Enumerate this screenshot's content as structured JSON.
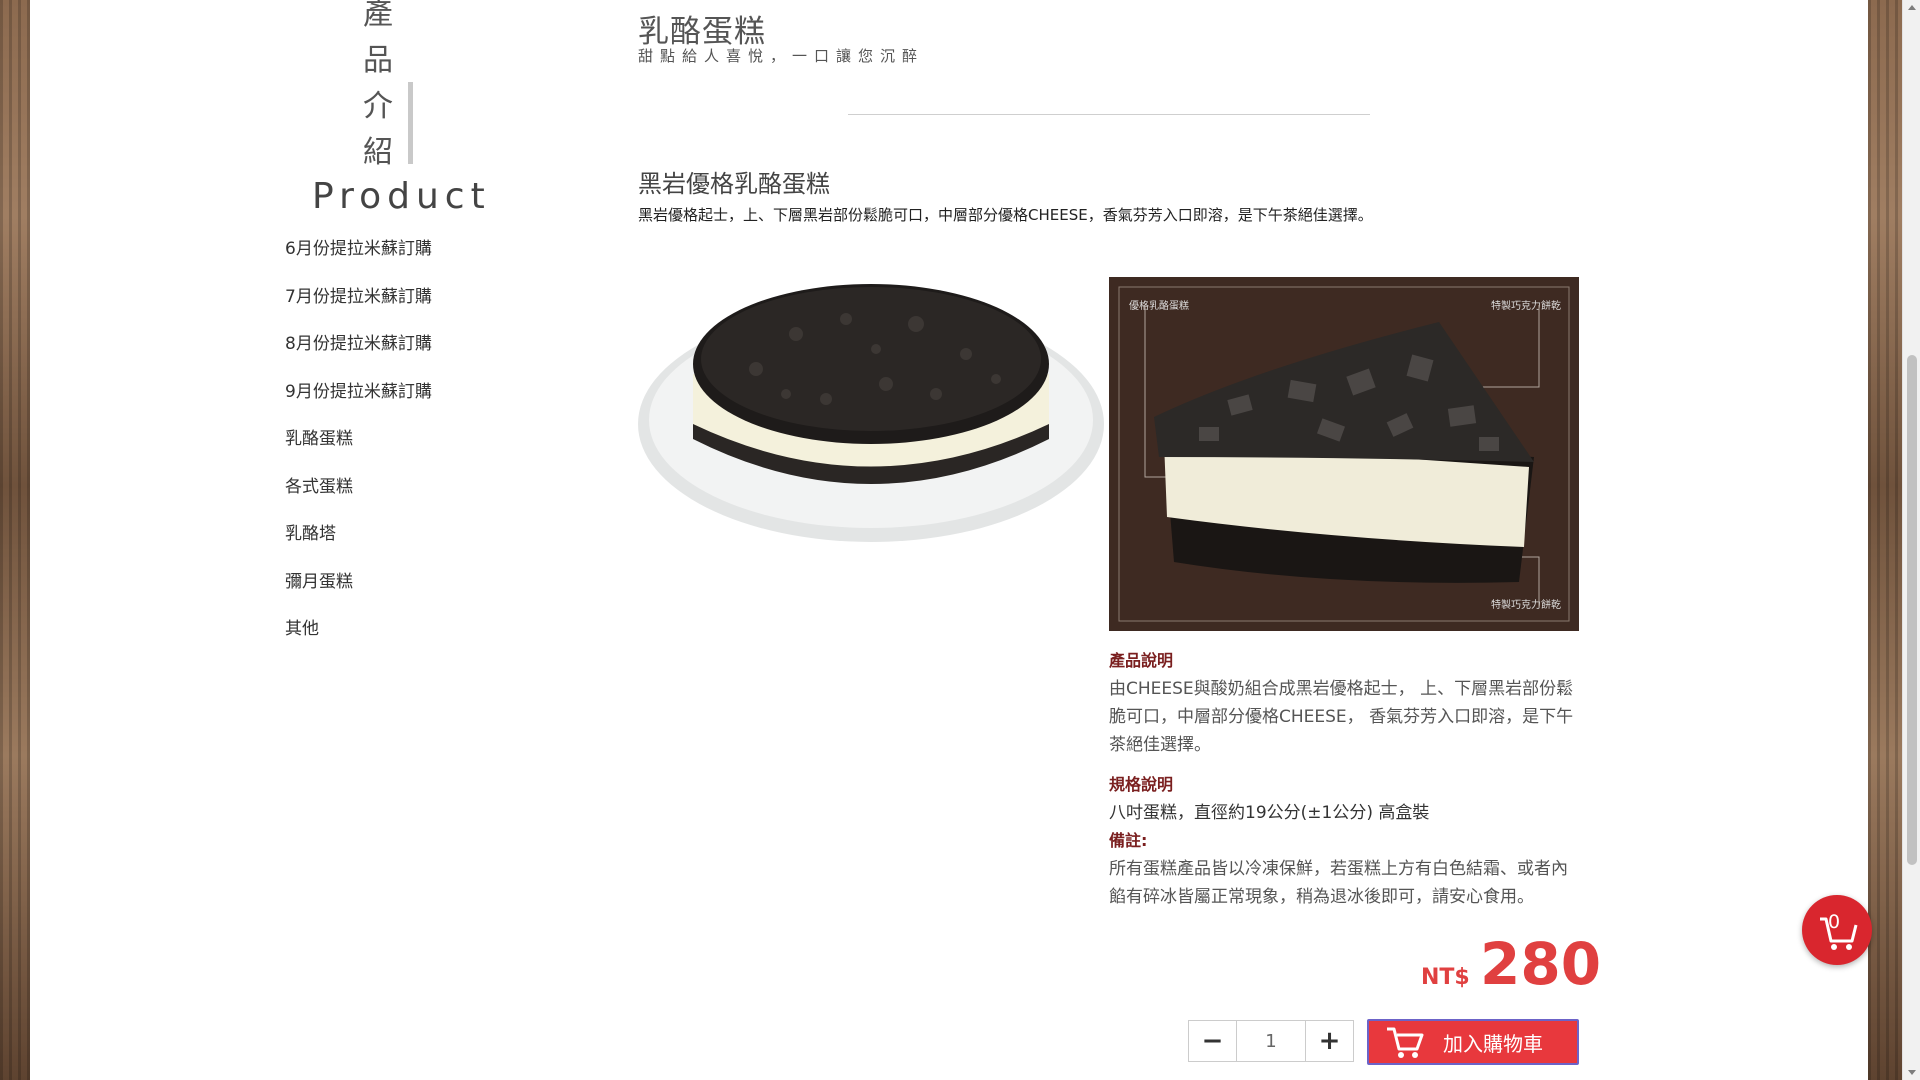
{
  "sidebar": {
    "title_cn": [
      "產",
      "品",
      "介",
      "紹"
    ],
    "title_en": "Product",
    "items": [
      "6月份提拉米蘇訂購",
      "7月份提拉米蘇訂購",
      "8月份提拉米蘇訂購",
      "9月份提拉米蘇訂購",
      "乳酪蛋糕",
      "各式蛋糕",
      "乳酪塔",
      "彌月蛋糕",
      "其他"
    ]
  },
  "category": {
    "title": "乳酪蛋糕",
    "subtitle": "甜點給人喜悅，一口讓您沉醉"
  },
  "product": {
    "name": "黑岩優格乳酪蛋糕",
    "short_desc": "黑岩優格起士，上、下層黑岩部份鬆脆可口，中層部分優格CHEESE，香氣芬芳入口即溶，是下午茶絕佳選擇。",
    "diagram_labels": {
      "top_left": "優格乳酪蛋糕",
      "top_right": "特製巧克力餅乾",
      "bottom_right": "特製巧克力餅乾"
    },
    "desc_heading": "產品說明",
    "desc_body": "由CHEESE與酸奶組合成黑岩優格起士， 上、下層黑岩部份鬆脆可口，中層部分優格CHEESE， 香氣芬芳入口即溶，是下午茶絕佳選擇。",
    "spec_heading": "規格說明",
    "spec_body": "八吋蛋糕，直徑約19公分(±1公分) 高盒裝",
    "note_heading": "備註:",
    "note_body": "所有蛋糕產品皆以冷凍保鮮，若蛋糕上方有白色結霜、或者內餡有碎冰皆屬正常現象，稍為退冰後即可，請安心食用。",
    "currency": "NT$",
    "price": "280",
    "quantity": "1",
    "add_to_cart": "加入購物車"
  },
  "cart": {
    "count": "0"
  },
  "colors": {
    "accent": "#e8383d",
    "heading": "#7a1f1f"
  }
}
